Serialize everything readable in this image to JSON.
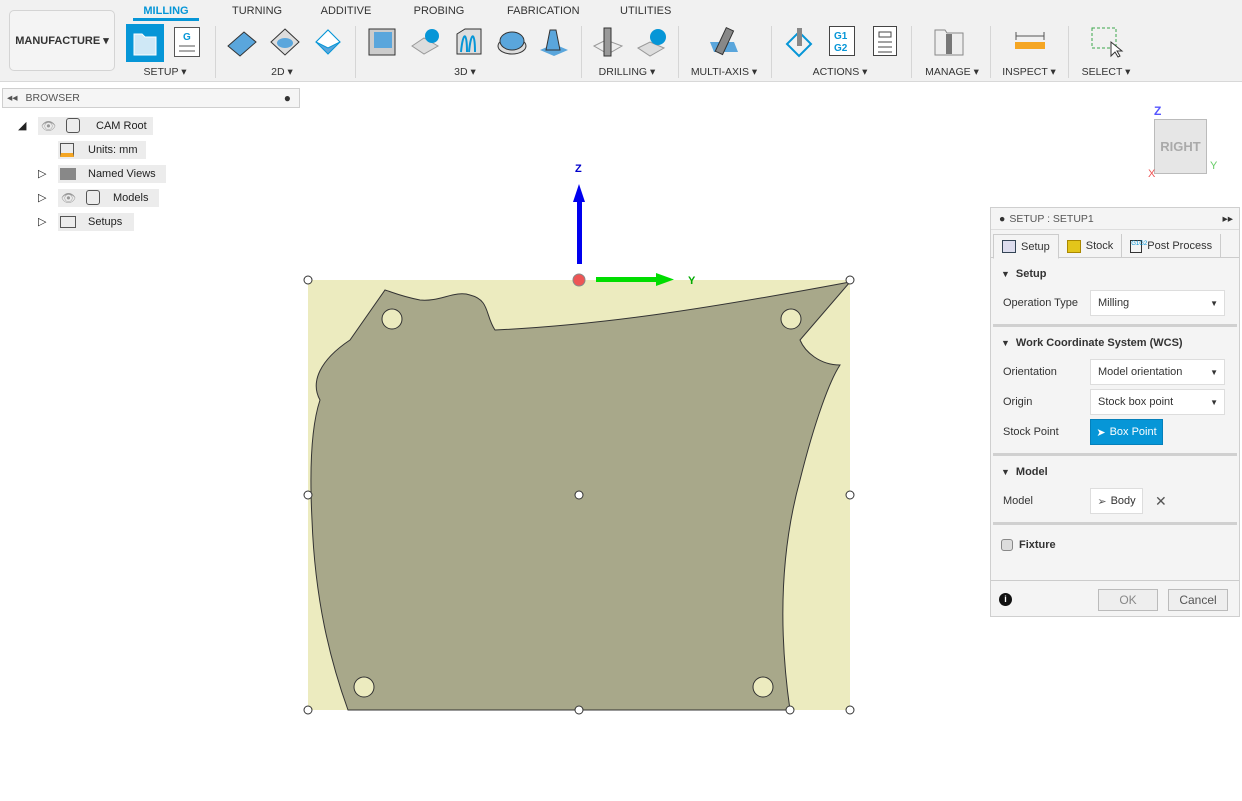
{
  "workspace": {
    "label": "MANUFACTURE"
  },
  "tabs": [
    "MILLING",
    "TURNING",
    "ADDITIVE",
    "PROBING",
    "FABRICATION",
    "UTILITIES"
  ],
  "groups": [
    "SETUP",
    "2D",
    "3D",
    "DRILLING",
    "MULTI-AXIS",
    "ACTIONS",
    "MANAGE",
    "INSPECT",
    "SELECT"
  ],
  "browser": {
    "title": "BROWSER",
    "nodes": [
      "CAM Root",
      "Units: mm",
      "Named Views",
      "Models",
      "Setups"
    ]
  },
  "viewcube": {
    "face": "RIGHT",
    "axes": {
      "z": "Z",
      "y": "Y",
      "x": "X"
    }
  },
  "triad": {
    "z": "Z",
    "y": "Y"
  },
  "panel": {
    "title": "SETUP : SETUP1",
    "tabs": [
      "Setup",
      "Stock",
      "Post Process"
    ],
    "setup_section": "Setup",
    "operation_type_label": "Operation Type",
    "operation_type": "Milling",
    "wcs_section": "Work Coordinate System (WCS)",
    "orientation_label": "Orientation",
    "orientation": "Model orientation",
    "origin_label": "Origin",
    "origin": "Stock box point",
    "stock_point_label": "Stock Point",
    "stock_point": "Box Point",
    "model_section": "Model",
    "model_label": "Model",
    "model": "Body",
    "fixture_label": "Fixture",
    "fixture_checked": false,
    "ok": "OK",
    "cancel": "Cancel"
  },
  "colors": {
    "accent": "#0696d7",
    "stock": "#ecebbf",
    "part": "#a8a88a"
  }
}
